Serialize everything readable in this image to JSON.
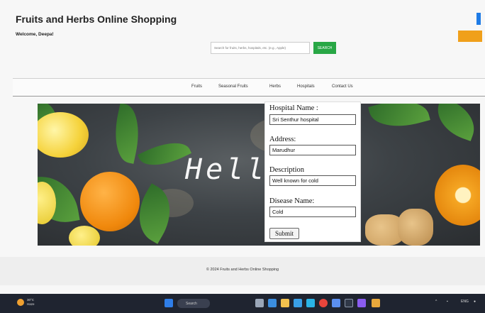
{
  "header": {
    "site_title": "Fruits and Herbs Online Shopping",
    "welcome": "Welcome, Deepa!"
  },
  "search": {
    "placeholder": "Search for fruits, herbs, hospitals, etc. (e.g., Apple)",
    "button_label": "SEARCH"
  },
  "nav": {
    "items": [
      {
        "label": "Fruits"
      },
      {
        "label": "Seasonal Fruits"
      },
      {
        "label": "Herbs"
      },
      {
        "label": "Hospitals"
      },
      {
        "label": "Contact Us"
      }
    ]
  },
  "banner": {
    "greeting": "Hello          a !"
  },
  "form": {
    "hospital_name_label": "Hospital Name :",
    "hospital_name_value": "Sri Senthur hospital",
    "address_label": "Address:",
    "address_value": "Marudhur",
    "description_label": "Description",
    "description_value": "Well known for cold",
    "disease_label": "Disease Name:",
    "disease_value": "Cold",
    "submit_label": "Submit"
  },
  "footer": {
    "copyright": "© 2024 Fruits and Herbs Online Shopping"
  },
  "taskbar": {
    "weather_temp": "30°C",
    "weather_desc": "Haze",
    "search_label": "Search",
    "time": "ENG",
    "colors": {
      "bg": "#1f2430",
      "accent": "#1e7be6"
    }
  },
  "colors": {
    "search_button": "#28a745",
    "orange_button": "#f0a01b",
    "blue_tab": "#1e7be6"
  }
}
